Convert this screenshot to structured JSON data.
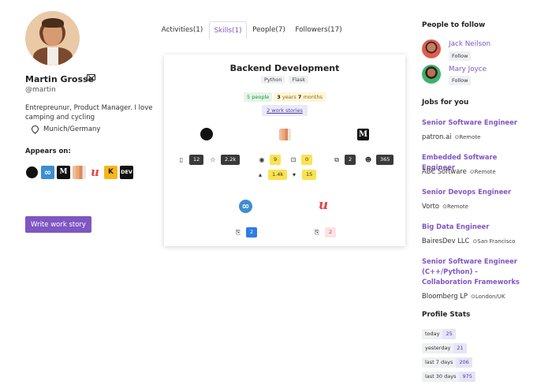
{
  "profile": {
    "name": "Martin Grosse",
    "handle": "@martin",
    "bio": "Entrepreunur, Product Manager. I love camping and cycling",
    "location": "Munich/Germany",
    "appears_on_label": "Appears on:",
    "appears_on_icons": [
      "github-icon",
      "infinity-icon",
      "medium-icon",
      "stackshare-icon",
      "udemy-icon",
      "kaggle-icon",
      "dev-icon"
    ],
    "write_button": "Write work story"
  },
  "tabs": [
    {
      "label": "Activities(1)",
      "active": false
    },
    {
      "label": "Skills(1)",
      "active": true
    },
    {
      "label": "People(7)",
      "active": false
    },
    {
      "label": "Followers(17)",
      "active": false
    }
  ],
  "skill_card": {
    "title": "Backend Development",
    "tags": [
      "Python",
      "Flask"
    ],
    "people": "5 people",
    "experience_num1": "3",
    "experience_text1": " years ",
    "experience_num2": "7",
    "experience_text2": " months",
    "stories_link": "2 work stories",
    "projects": [
      {
        "icon": "github-icon",
        "stats": [
          {
            "icon": "repo-icon",
            "value": "12"
          },
          {
            "icon": "star-icon",
            "value": "2.2k"
          }
        ]
      },
      {
        "icon": "stackshare-icon",
        "stats": [
          {
            "icon": "eye-icon",
            "value": "9"
          },
          {
            "icon": "issue-icon",
            "value": "0"
          },
          {
            "icon": "upvote-icon",
            "value": "1.4k"
          },
          {
            "icon": "downvote-icon",
            "value": "15"
          }
        ]
      },
      {
        "icon": "medium-icon",
        "stats": [
          {
            "icon": "articles-icon",
            "value": "2"
          },
          {
            "icon": "followers-icon",
            "value": "365"
          }
        ]
      },
      {
        "icon": "infinity-icon",
        "stats": [
          {
            "icon": "course-icon",
            "value": "2"
          }
        ]
      },
      {
        "icon": "udemy-icon",
        "stats": [
          {
            "icon": "course-icon",
            "value": "2"
          }
        ]
      }
    ]
  },
  "people_to_follow": {
    "title": "People to follow",
    "people": [
      {
        "name": "Jack Neilson",
        "follow": "Follow"
      },
      {
        "name": "Mary Joyce",
        "follow": "Follow"
      }
    ]
  },
  "jobs": {
    "title": "Jobs for you",
    "items": [
      {
        "title": "Senior Software Engineer",
        "company": "patron.ai",
        "location": "Remote"
      },
      {
        "title": "Embedded Software Engineer",
        "company": "ABC Software",
        "location": "Remote"
      },
      {
        "title": "Senior Devops Engineer",
        "company": "Vorto",
        "location": "Remote"
      },
      {
        "title": "Big Data Engineer",
        "company": "BairesDev LLC",
        "location": "San Francisco"
      },
      {
        "title": "Senior Software Engineer (C++/Python) - Collaboration Frameworks",
        "company": "Bloomberg LP",
        "location": "London/UK"
      }
    ]
  },
  "profile_stats": {
    "title": "Profile Stats",
    "rows": [
      {
        "label": "today",
        "value": "25"
      },
      {
        "label": "yesterday",
        "value": "21"
      },
      {
        "label": "last 7 days",
        "value": "206"
      },
      {
        "label": "last 30 days",
        "value": "975"
      }
    ]
  },
  "colors": {
    "accent": "#7e57c2",
    "badge_dark": "#3a3a3a",
    "badge_yellow": "#fbe250",
    "badge_blue": "#2e7de0"
  }
}
